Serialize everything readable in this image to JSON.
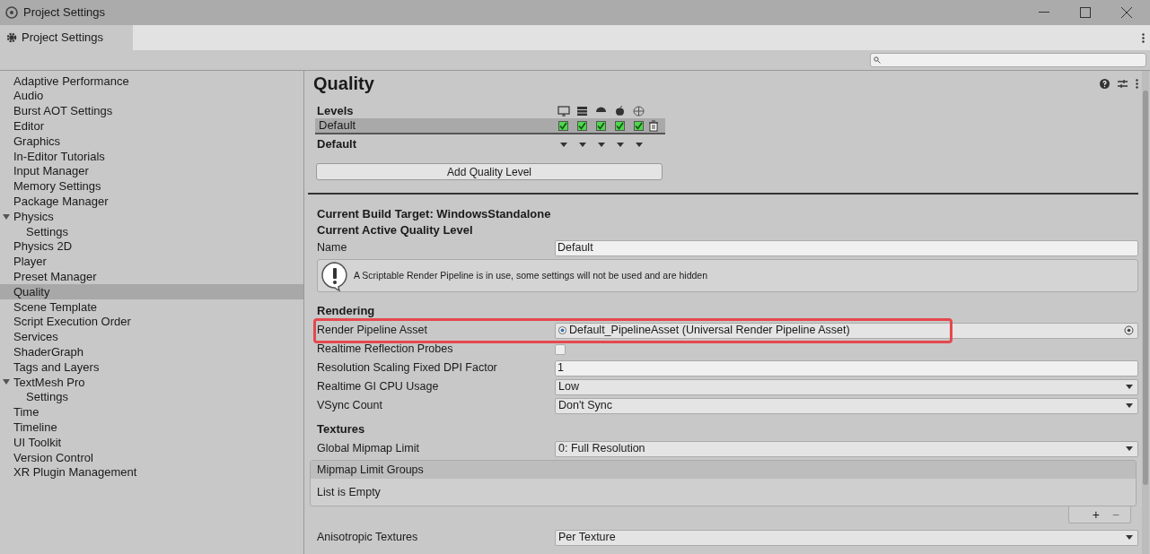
{
  "window": {
    "title": "Project Settings"
  },
  "tab": {
    "label": "Project Settings",
    "selected": true
  },
  "sidebar": {
    "items": [
      {
        "label": "Adaptive Performance",
        "selected": false
      },
      {
        "label": "Audio",
        "selected": false
      },
      {
        "label": "Burst AOT Settings",
        "selected": false
      },
      {
        "label": "Editor",
        "selected": false
      },
      {
        "label": "Graphics",
        "selected": false
      },
      {
        "label": "In-Editor Tutorials",
        "selected": false
      },
      {
        "label": "Input Manager",
        "selected": false
      },
      {
        "label": "Memory Settings",
        "selected": false
      },
      {
        "label": "Package Manager",
        "selected": false
      },
      {
        "label": "Physics",
        "selected": false,
        "expanded": true,
        "children": [
          {
            "label": "Settings",
            "selected": false
          }
        ]
      },
      {
        "label": "Physics 2D",
        "selected": false
      },
      {
        "label": "Player",
        "selected": false
      },
      {
        "label": "Preset Manager",
        "selected": false
      },
      {
        "label": "Quality",
        "selected": true
      },
      {
        "label": "Scene Template",
        "selected": false
      },
      {
        "label": "Script Execution Order",
        "selected": false
      },
      {
        "label": "Services",
        "selected": false
      },
      {
        "label": "ShaderGraph",
        "selected": false
      },
      {
        "label": "Tags and Layers",
        "selected": false
      },
      {
        "label": "TextMesh Pro",
        "selected": false,
        "expanded": true,
        "children": [
          {
            "label": "Settings",
            "selected": false
          }
        ]
      },
      {
        "label": "Time",
        "selected": false
      },
      {
        "label": "Timeline",
        "selected": false
      },
      {
        "label": "UI Toolkit",
        "selected": false
      },
      {
        "label": "Version Control",
        "selected": false
      },
      {
        "label": "XR Plugin Management",
        "selected": false
      }
    ]
  },
  "content": {
    "title": "Quality",
    "levels": {
      "heading": "Levels",
      "platforms": [
        {
          "kind": "monitor"
        },
        {
          "kind": "server"
        },
        {
          "kind": "android"
        },
        {
          "kind": "apple"
        },
        {
          "kind": "webgl"
        }
      ],
      "rows": [
        {
          "name": "Default",
          "selected": true,
          "enabled": [
            true,
            true,
            true,
            true,
            true
          ]
        }
      ],
      "default_label": "Default",
      "add_button": "Add Quality Level"
    },
    "build_target": "Current Build Target: WindowsStandalone",
    "active_level": "Current Active Quality Level",
    "name_field": {
      "label": "Name",
      "value": "Default"
    },
    "help_box": "A Scriptable Render Pipeline is in use, some settings will not be used and are hidden",
    "sections": [
      {
        "heading": "Rendering",
        "properties": [
          {
            "kind": "object",
            "label": "Render Pipeline Asset",
            "value": "Default_PipelineAsset (Universal Render Pipeline Asset)",
            "highlighted": true
          },
          {
            "kind": "checkbox",
            "label": "Realtime Reflection Probes",
            "checked": false
          },
          {
            "kind": "text",
            "label": "Resolution Scaling Fixed DPI Factor",
            "value": "1"
          },
          {
            "kind": "dropdown",
            "label": "Realtime GI CPU Usage",
            "value": "Low"
          },
          {
            "kind": "dropdown",
            "label": "VSync Count",
            "value": "Don't Sync"
          }
        ]
      },
      {
        "heading": "Textures",
        "properties": [
          {
            "kind": "dropdown",
            "label": "Global Mipmap Limit",
            "value": "0: Full Resolution"
          },
          {
            "kind": "list",
            "label": "Mipmap Limit Groups",
            "empty_text": "List is Empty",
            "add_label": "+",
            "remove_label": "−"
          },
          {
            "kind": "dropdown",
            "label": "Anisotropic Textures",
            "value": "Per Texture"
          }
        ]
      }
    ]
  }
}
